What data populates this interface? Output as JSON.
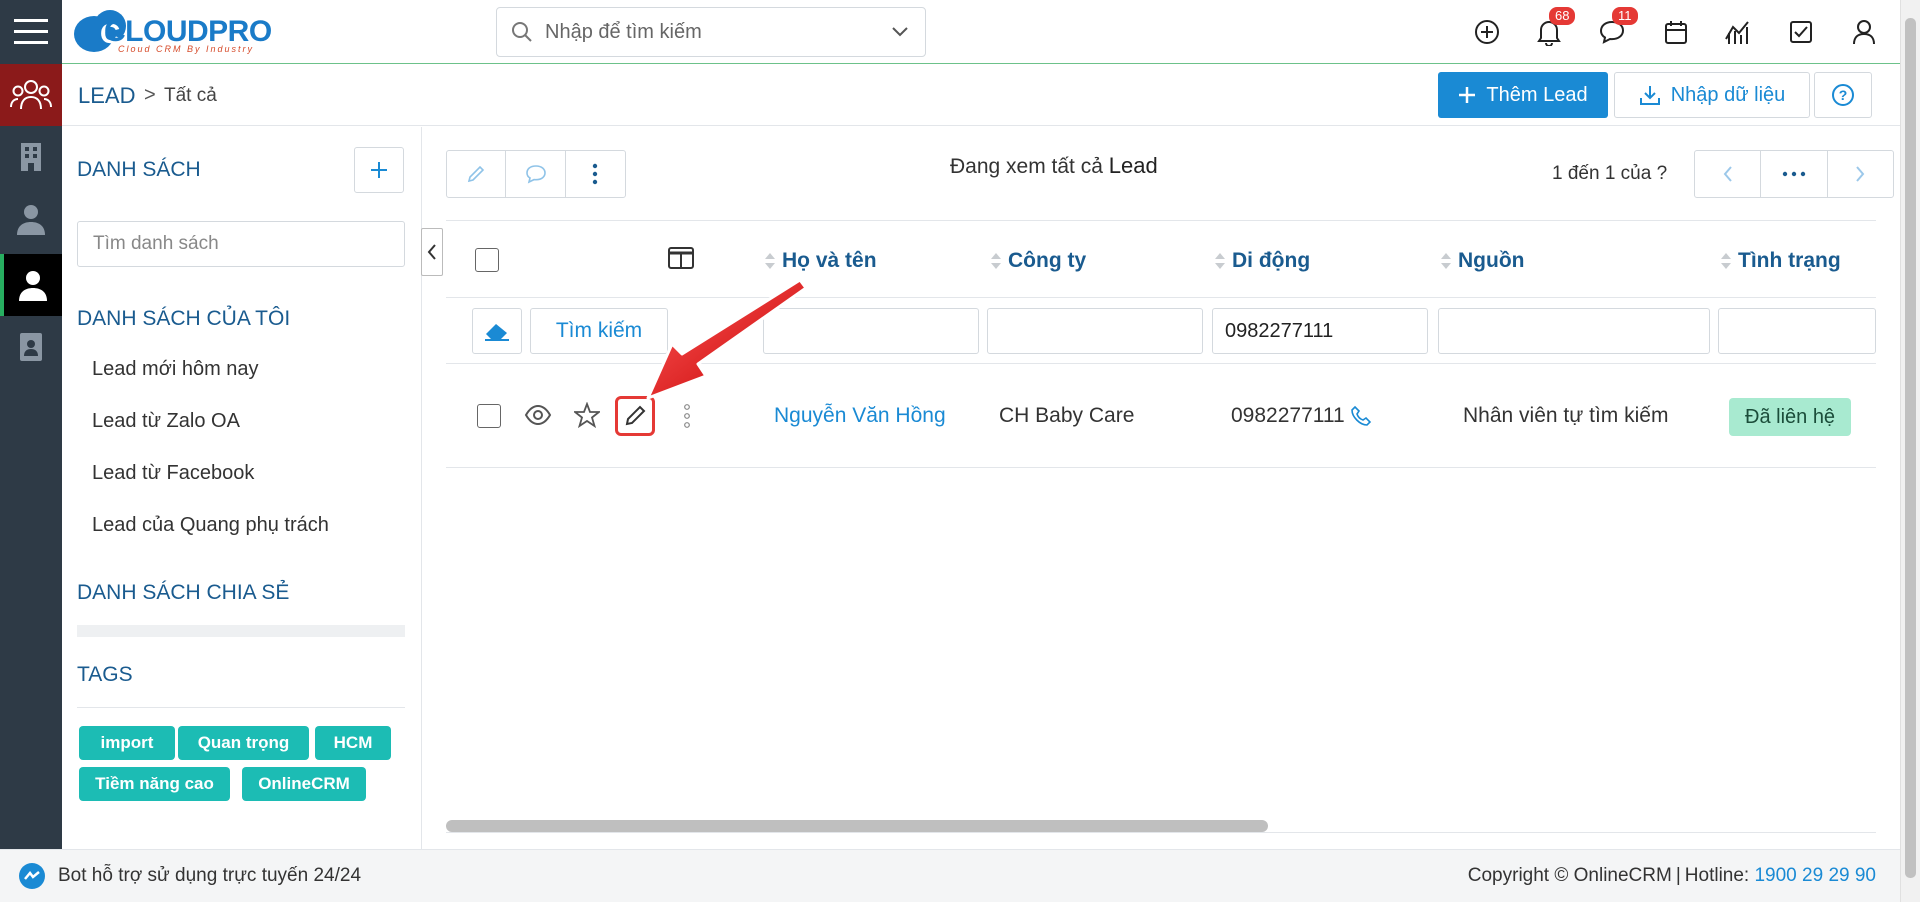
{
  "header": {
    "logo": {
      "brand": "CLOUDPRO",
      "tagline": "Cloud CRM By Industry"
    },
    "search_placeholder": "Nhập để tìm kiếm",
    "notifications_count": "68",
    "messages_count": "11"
  },
  "breadcrumb": {
    "module": "LEAD",
    "separator": ">",
    "current": "Tất cả"
  },
  "actions": {
    "add_label": "Thêm Lead",
    "import_label": "Nhập dữ liệu"
  },
  "sidebar": {
    "lists_title": "DANH SÁCH",
    "list_search_placeholder": "Tìm danh sách",
    "my_lists_title": "DANH SÁCH CỦA TÔI",
    "my_lists": [
      "Lead mới hôm nay",
      "Lead từ Zalo OA",
      "Lead từ Facebook",
      "Lead của Quang phụ trách"
    ],
    "shared_title": "DANH SÁCH CHIA SẺ",
    "tags_title": "TAGS",
    "tags": [
      "import",
      "Quan trọng",
      "HCM",
      "Tiềm năng cao",
      "OnlineCRM"
    ]
  },
  "main": {
    "viewing_prefix": "Đang xem tất cả",
    "viewing_module": "Lead",
    "pager_text": "1 đến 1 của ?",
    "columns": [
      "Họ và tên",
      "Công ty",
      "Di động",
      "Nguồn",
      "Tình trạng"
    ],
    "filter": {
      "button_label": "Tìm kiếm",
      "mobile_value": "0982277111"
    },
    "rows": [
      {
        "name": "Nguyễn Văn Hồng",
        "company": "CH Baby Care",
        "mobile": "0982277111",
        "source": "Nhân viên tự tìm kiếm",
        "status": "Đã liên hệ"
      }
    ]
  },
  "footer": {
    "bot_text": "Bot hỗ trợ sử dụng trực tuyến 24/24",
    "copyright": "Copyright © OnlineCRM",
    "hotline_label": "Hotline:",
    "hotline": "1900 29 29 90"
  },
  "colors": {
    "primary": "#1a8ad4",
    "dark_sidebar": "#2e3a46",
    "active_sidebar": "#8b1a1a",
    "tag": "#1cbcb4",
    "status_bg": "#a8ead0"
  }
}
